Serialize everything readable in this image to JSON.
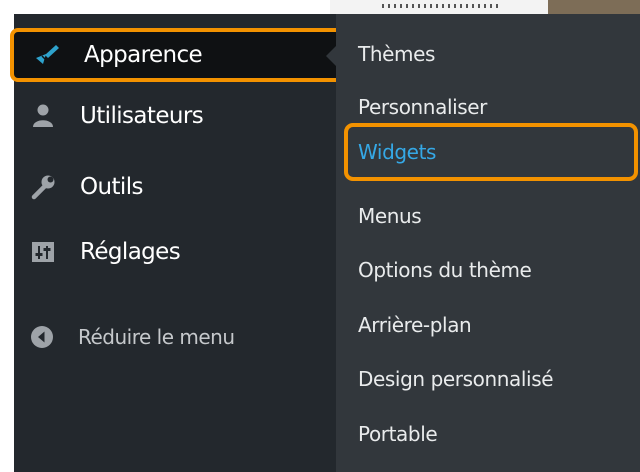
{
  "sidebar": {
    "items": [
      {
        "label": "Apparence",
        "icon": "paintbrush-icon"
      },
      {
        "label": "Utilisateurs",
        "icon": "user-icon"
      },
      {
        "label": "Outils",
        "icon": "wrench-icon"
      },
      {
        "label": "Réglages",
        "icon": "settings-icon"
      }
    ],
    "collapse_label": "Réduire le menu",
    "collapse_icon": "collapse-arrow-icon"
  },
  "submenu": {
    "items": [
      "Thèmes",
      "Personnaliser",
      "Widgets",
      "Menus",
      "Options du thème",
      "Arrière-plan",
      "Design personnalisé",
      "Portable"
    ],
    "active": "Widgets"
  },
  "colors": {
    "sidebar_bg": "#23282d",
    "submenu_bg": "#32373c",
    "active_text": "#35a8e6",
    "highlight": "#f39200"
  }
}
